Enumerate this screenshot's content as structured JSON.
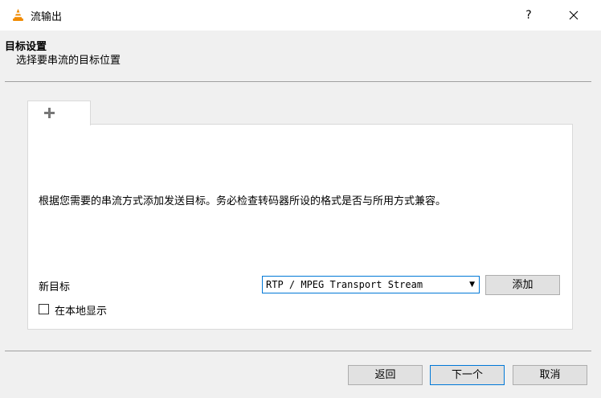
{
  "window": {
    "title": "流输出",
    "help_label": "?",
    "close_label": "✕"
  },
  "header": {
    "title": "目标设置",
    "subtitle": "选择要串流的目标位置"
  },
  "tabs": [
    {
      "icon": "plus-icon"
    }
  ],
  "panel": {
    "description": "根据您需要的串流方式添加发送目标。务必检查转码器所设的格式是否与所用方式兼容。",
    "new_target_label": "新目标",
    "target_select": {
      "value": "RTP / MPEG Transport Stream"
    },
    "add_button": "添加",
    "local_display": {
      "label": "在本地显示",
      "checked": false
    }
  },
  "footer": {
    "back": "返回",
    "next": "下一个",
    "cancel": "取消"
  },
  "colors": {
    "accent": "#0078d7",
    "vlc_orange": "#f08a00"
  }
}
